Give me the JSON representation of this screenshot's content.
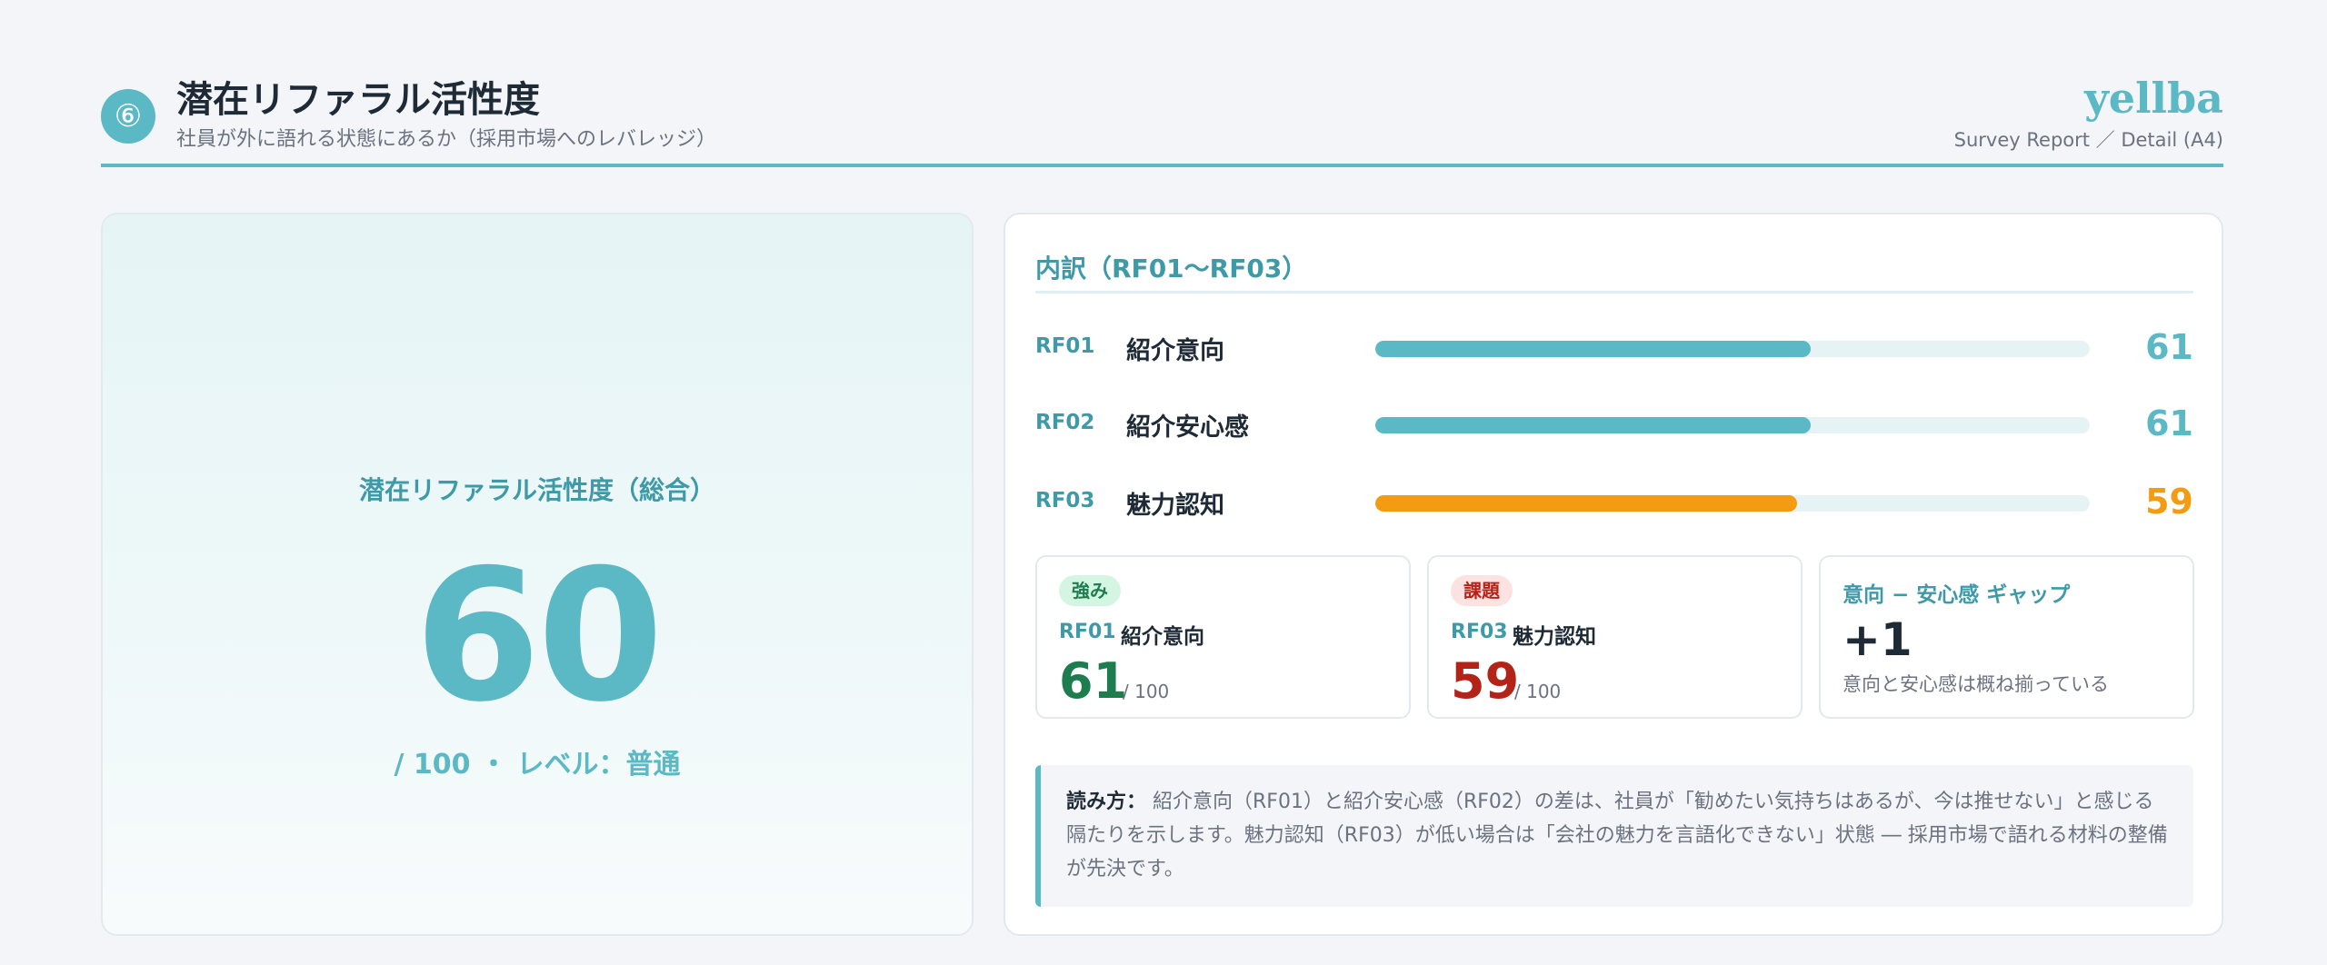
{
  "header": {
    "section_number": "⑥",
    "title": "潜在リファラル活性度",
    "subtitle": "社員が外に語れる状態にあるか（採用市場へのレバレッジ）",
    "brand": "yellba",
    "brand_sub": "Survey Report ／ Detail (A4)"
  },
  "overall": {
    "label": "潜在リファラル活性度（総合）",
    "score": "60",
    "level_text": "/ 100 ・ レベル：普通"
  },
  "breakdown": {
    "title": "内訳（RF01〜RF03）",
    "rows": [
      {
        "code": "RF01",
        "name": "紹介意向",
        "value": 61,
        "display": "61",
        "color": "#5bb8c5"
      },
      {
        "code": "RF02",
        "name": "紹介安心感",
        "value": 61,
        "display": "61",
        "color": "#5bb8c5"
      },
      {
        "code": "RF03",
        "name": "魅力認知",
        "value": 59,
        "display": "59",
        "color": "#f39c12"
      }
    ]
  },
  "strength": {
    "chip": "強み",
    "code": "RF01",
    "name": "紹介意向",
    "value": "61",
    "max": "/ 100",
    "chip_bg": "#d5f5e3",
    "chip_color": "#1e7d4f",
    "value_color": "#1e7d4f"
  },
  "issue": {
    "chip": "課題",
    "code": "RF03",
    "name": "魅力認知",
    "value": "59",
    "max": "/ 100",
    "chip_bg": "#fde2e2",
    "chip_color": "#b42318",
    "value_color": "#b42318"
  },
  "gap": {
    "title": "意向 − 安心感 ギャップ",
    "value": "+1",
    "note": "意向と安心感は概ね揃っている"
  },
  "reading": {
    "label": "読み方：",
    "text": "紹介意向（RF01）と紹介安心感（RF02）の差は、社員が「勧めたい気持ちはあるが、今は推せない」と感じる隔たりを示します。魅力認知（RF03）が低い場合は「会社の魅力を言語化できない」状態 ― 採用市場で語れる材料の整備が先決です。"
  },
  "colors": {
    "accent": "#5bb8c5",
    "accent_dark": "#3f9aa8",
    "warning": "#f39c12"
  }
}
